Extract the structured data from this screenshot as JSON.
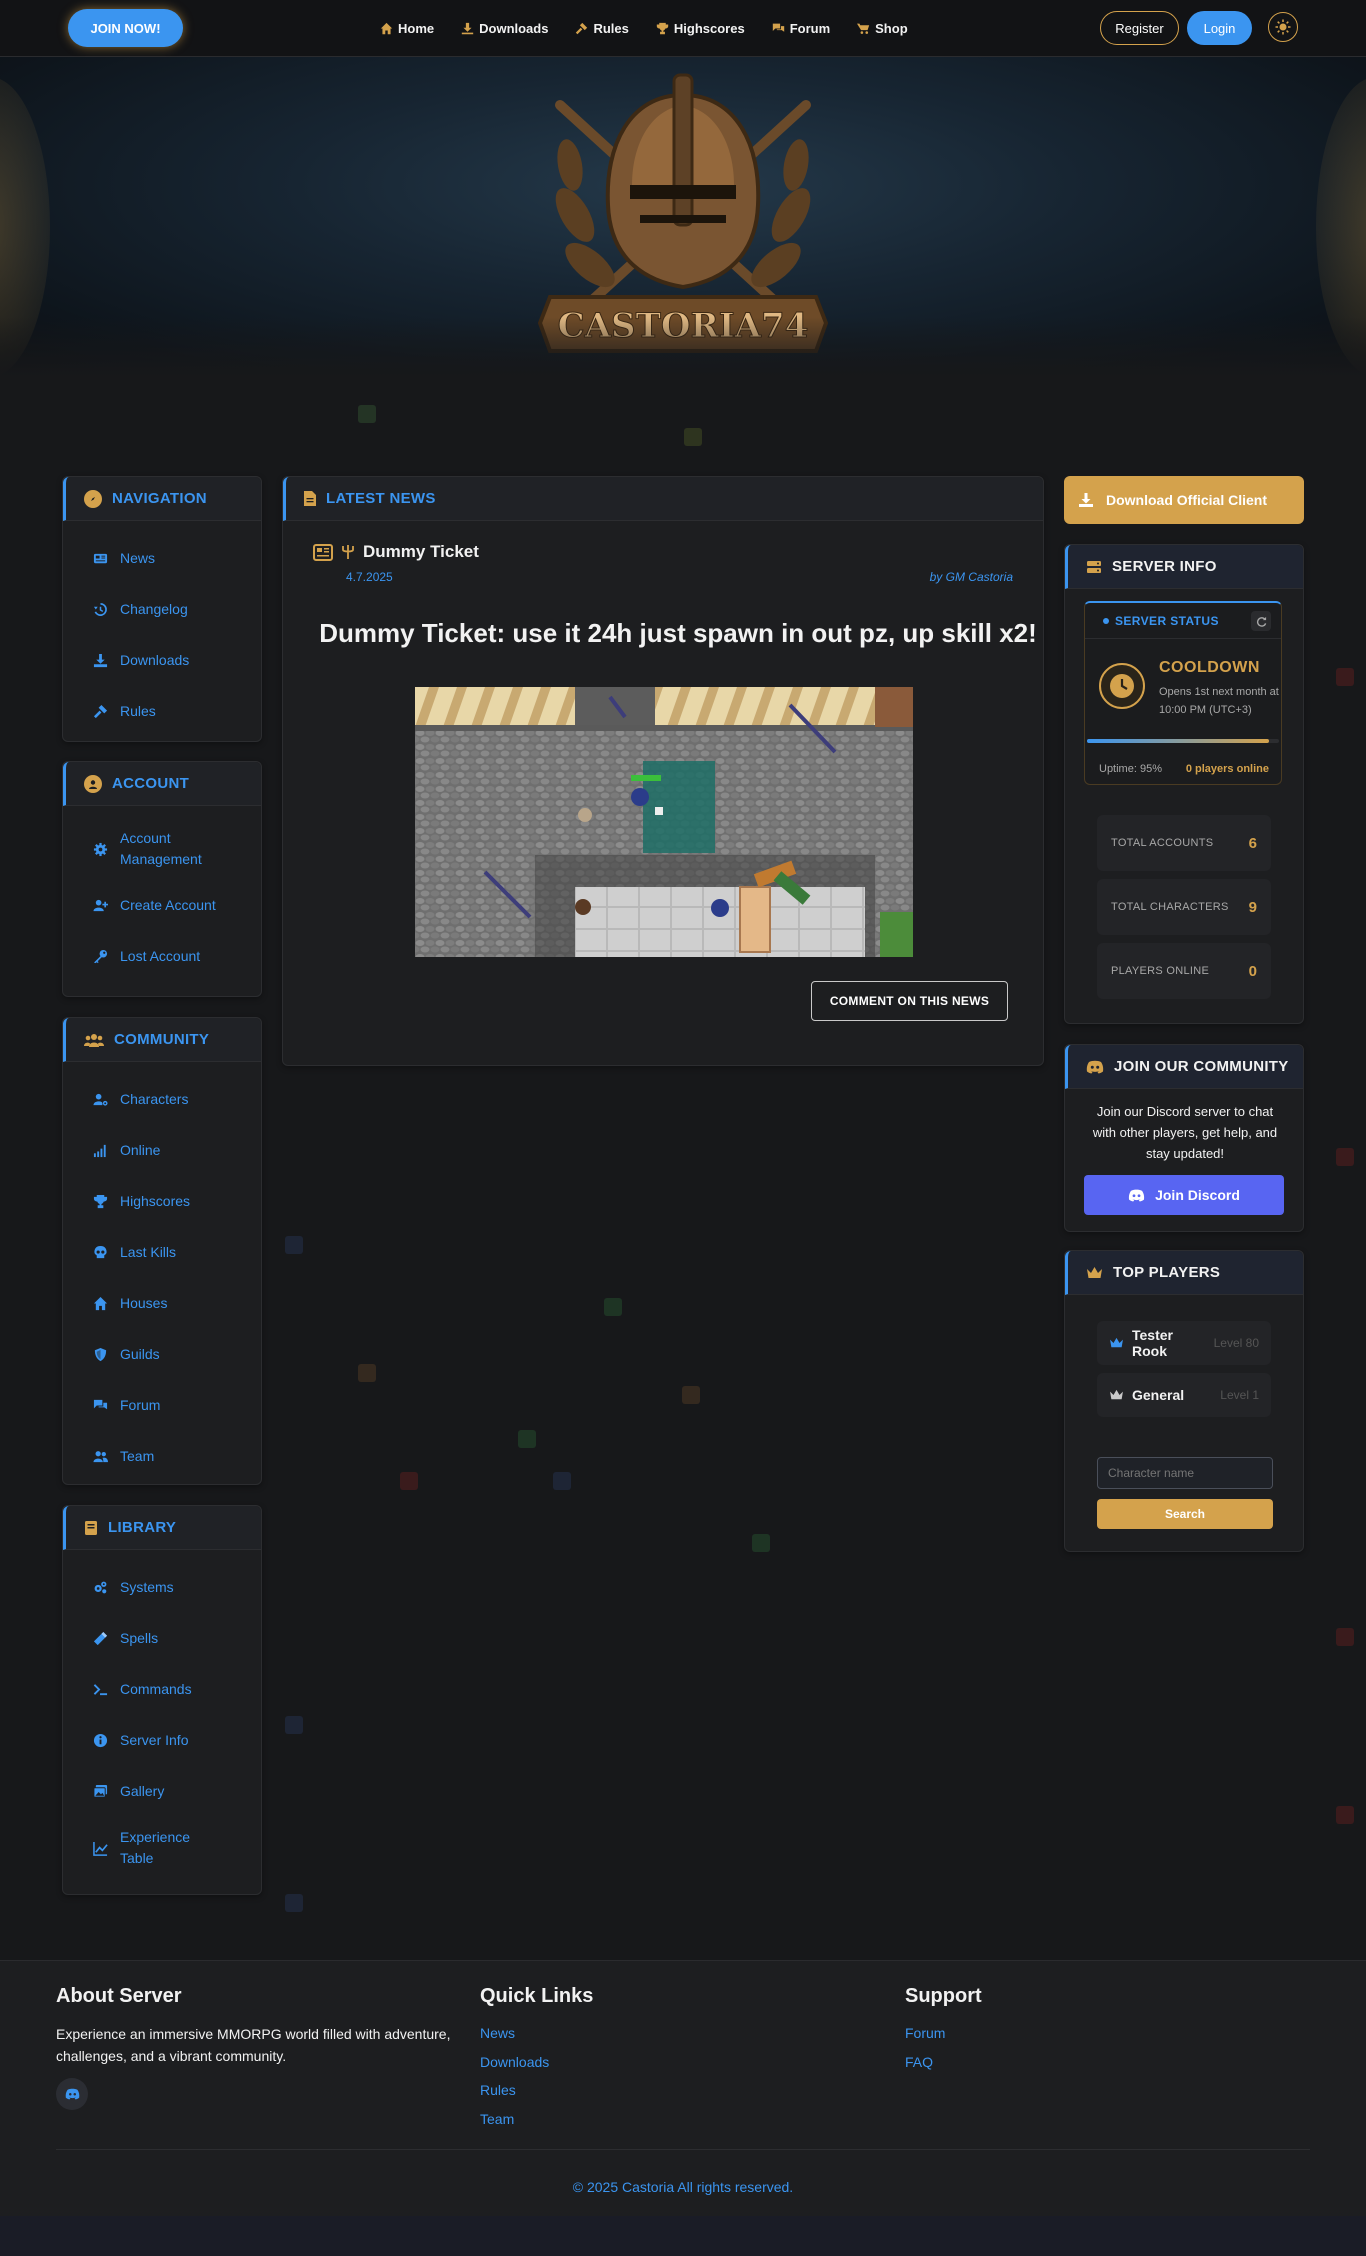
{
  "topbar": {
    "join_label": "JOIN NOW!",
    "nav": [
      {
        "label": "Home",
        "icon": "home-icon"
      },
      {
        "label": "Downloads",
        "icon": "download-icon"
      },
      {
        "label": "Rules",
        "icon": "gavel-icon"
      },
      {
        "label": "Highscores",
        "icon": "trophy-icon"
      },
      {
        "label": "Forum",
        "icon": "comments-icon"
      },
      {
        "label": "Shop",
        "icon": "cart-icon"
      }
    ],
    "register_label": "Register",
    "login_label": "Login"
  },
  "hero": {
    "logo_text": "CASTORIA74"
  },
  "sidebar": {
    "navigation": {
      "title": "NAVIGATION",
      "items": [
        "News",
        "Changelog",
        "Downloads",
        "Rules"
      ]
    },
    "account": {
      "title": "ACCOUNT",
      "items": [
        "Account Management",
        "Create Account",
        "Lost Account"
      ]
    },
    "community": {
      "title": "COMMUNITY",
      "items": [
        "Characters",
        "Online",
        "Highscores",
        "Last Kills",
        "Houses",
        "Guilds",
        "Forum",
        "Team"
      ]
    },
    "library": {
      "title": "LIBRARY",
      "items": [
        "Systems",
        "Spells",
        "Commands",
        "Server Info",
        "Gallery",
        "Experience Table"
      ]
    }
  },
  "news": {
    "section_title": "LATEST NEWS",
    "title": "Dummy Ticket",
    "date": "4.7.2025",
    "author_prefix": "by ",
    "author": "GM Castoria",
    "headline": "Dummy Ticket: use it 24h just spawn in out pz, up skill x2!",
    "comment_label": "COMMENT ON THIS NEWS"
  },
  "right": {
    "download_label": "Download Official Client",
    "server_info": {
      "title": "SERVER INFO",
      "status_label": "SERVER STATUS",
      "status": "COOLDOWN",
      "status_detail": "Opens 1st next month at 10:00 PM (UTC+3)",
      "uptime": "Uptime: 95%",
      "uptime_fraction": 0.95,
      "online": "0 players online",
      "stats": [
        {
          "label": "TOTAL ACCOUNTS",
          "value": "6"
        },
        {
          "label": "TOTAL CHARACTERS",
          "value": "9"
        },
        {
          "label": "PLAYERS ONLINE",
          "value": "0"
        }
      ]
    },
    "community": {
      "title": "JOIN OUR COMMUNITY",
      "text": "Join our Discord server to chat with other players, get help, and stay updated!",
      "button": "Join Discord"
    },
    "top_players": {
      "title": "TOP PLAYERS",
      "players": [
        {
          "name": "Tester Rook",
          "level": "Level 80"
        },
        {
          "name": "General",
          "level": "Level 1"
        }
      ],
      "search_placeholder": "Character name",
      "search_label": "Search"
    }
  },
  "footer": {
    "about_title": "About Server",
    "about_text": "Experience an immersive MMORPG world filled with adventure, challenges, and a vibrant community.",
    "quick_title": "Quick Links",
    "quick_links": [
      "News",
      "Downloads",
      "Rules",
      "Team"
    ],
    "support_title": "Support",
    "support_links": [
      "Forum",
      "FAQ"
    ],
    "copyright": "© 2025 Castoria All rights reserved."
  },
  "colors": {
    "accent": "#3b95f0",
    "gold": "#d4a24c",
    "background": "#17181a",
    "discord": "#5865f2"
  }
}
